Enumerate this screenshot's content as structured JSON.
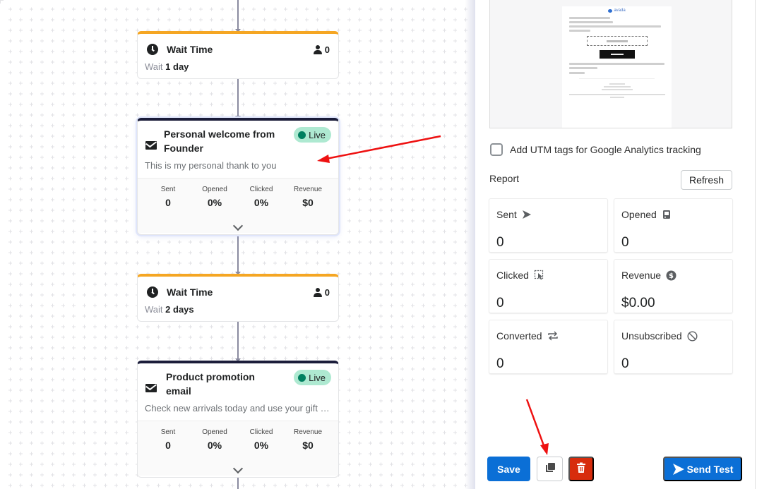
{
  "flow": {
    "wait_steps": [
      {
        "title": "Wait Time",
        "count": "0",
        "wait_prefix": "Wait",
        "wait_value": "1 day"
      },
      {
        "title": "Wait Time",
        "count": "0",
        "wait_prefix": "Wait",
        "wait_value": "2 days"
      }
    ],
    "email_steps": [
      {
        "title": "Personal welcome from Founder",
        "status": "Live",
        "description": "This is my personal thank to you",
        "stats": [
          {
            "label": "Sent",
            "value": "0"
          },
          {
            "label": "Opened",
            "value": "0%"
          },
          {
            "label": "Clicked",
            "value": "0%"
          },
          {
            "label": "Revenue",
            "value": "$0"
          }
        ]
      },
      {
        "title": "Product promotion email",
        "status": "Live",
        "description": "Check new arrivals today and use your gift c...",
        "stats": [
          {
            "label": "Sent",
            "value": "0"
          },
          {
            "label": "Opened",
            "value": "0%"
          },
          {
            "label": "Clicked",
            "value": "0%"
          },
          {
            "label": "Revenue",
            "value": "$0"
          }
        ]
      }
    ]
  },
  "panel": {
    "preview": {
      "logo_text": "avada"
    },
    "utm_label": "Add UTM tags for Google Analytics tracking",
    "utm_checked": false,
    "report_label": "Report",
    "refresh_label": "Refresh",
    "metrics": [
      {
        "label": "Sent",
        "icon": "send-icon",
        "value": "0"
      },
      {
        "label": "Opened",
        "icon": "inbox-icon",
        "value": "0"
      },
      {
        "label": "Clicked",
        "icon": "click-select-icon",
        "value": "0"
      },
      {
        "label": "Revenue",
        "icon": "dollar-circle-icon",
        "value": "$0.00"
      },
      {
        "label": "Converted",
        "icon": "repeat-icon",
        "value": "0"
      },
      {
        "label": "Unsubscribed",
        "icon": "block-icon",
        "value": "0"
      }
    ],
    "save_label": "Save",
    "send_test_label": "Send Test"
  },
  "colors": {
    "wait_accent": "#f5a623",
    "email_accent": "#1b1d3a",
    "live_badge": "#aee9d1",
    "live_dot": "#007f5f",
    "primary": "#0b6fd6",
    "danger": "#d72c0d",
    "annotation_arrow": "#ee1111"
  }
}
